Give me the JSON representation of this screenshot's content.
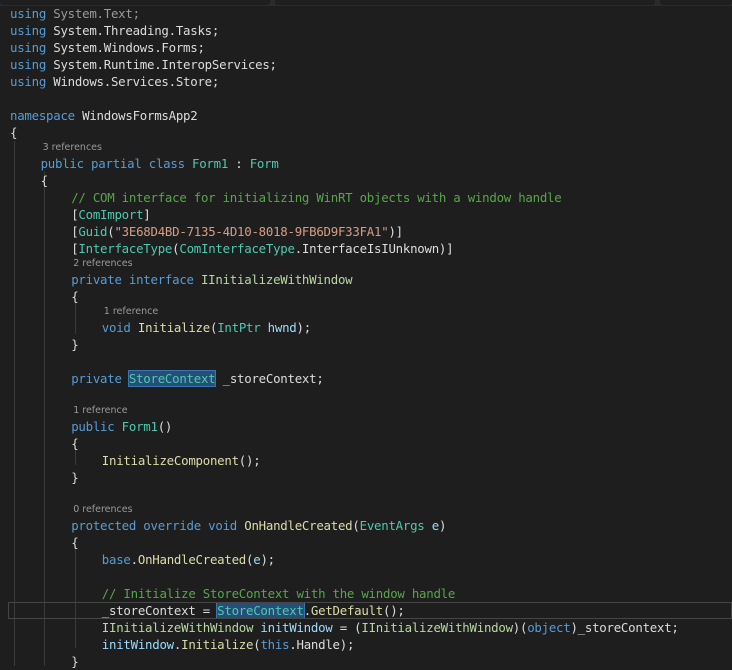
{
  "colors": {
    "background": "#1e1e1e",
    "keyword": "#569cd6",
    "type": "#4ec9b0",
    "string": "#d69d85",
    "comment": "#57a64a",
    "method": "#dcdcaa",
    "variable": "#9cdcfe",
    "highlight": "#264f78"
  },
  "editor": {
    "lines": [
      {
        "indent": 0,
        "tokens": [
          [
            "using ",
            "k"
          ],
          [
            "System.Text;",
            "d"
          ]
        ]
      },
      {
        "indent": 0,
        "tokens": [
          [
            "using ",
            "k"
          ],
          [
            "System.Threading.Tasks;",
            "p"
          ]
        ]
      },
      {
        "indent": 0,
        "tokens": [
          [
            "using ",
            "k"
          ],
          [
            "System.Windows.Forms;",
            "p"
          ]
        ]
      },
      {
        "indent": 0,
        "tokens": [
          [
            "using ",
            "k"
          ],
          [
            "System.Runtime.InteropServices;",
            "p"
          ]
        ]
      },
      {
        "indent": 0,
        "tokens": [
          [
            "using ",
            "k"
          ],
          [
            "Windows.Services.Store;",
            "p"
          ]
        ]
      },
      {
        "indent": 0,
        "tokens": []
      },
      {
        "indent": 0,
        "tokens": [
          [
            "namespace ",
            "k"
          ],
          [
            "WindowsFormsApp2",
            "p"
          ]
        ]
      },
      {
        "indent": 0,
        "tokens": [
          [
            "{",
            "p"
          ]
        ]
      },
      {
        "indent": 1,
        "lens": "3 references"
      },
      {
        "indent": 1,
        "tokens": [
          [
            "public partial class ",
            "k"
          ],
          [
            "Form1",
            "t"
          ],
          [
            " : ",
            "p"
          ],
          [
            "Form",
            "t"
          ]
        ]
      },
      {
        "indent": 1,
        "tokens": [
          [
            "{",
            "p"
          ]
        ]
      },
      {
        "indent": 2,
        "tokens": [
          [
            "// COM interface for initializing WinRT objects with a window handle",
            "c"
          ]
        ]
      },
      {
        "indent": 2,
        "tokens": [
          [
            "[",
            "p"
          ],
          [
            "ComImport",
            "t"
          ],
          [
            "]",
            "p"
          ]
        ]
      },
      {
        "indent": 2,
        "tokens": [
          [
            "[",
            "p"
          ],
          [
            "Guid",
            "t"
          ],
          [
            "(",
            "p"
          ],
          [
            "\"3E68D4BD-7135-4D10-8018-9FB6D9F33FA1\"",
            "s"
          ],
          [
            ")]",
            "p"
          ]
        ]
      },
      {
        "indent": 2,
        "tokens": [
          [
            "[",
            "p"
          ],
          [
            "InterfaceType",
            "t"
          ],
          [
            "(",
            "p"
          ],
          [
            "ComInterfaceType",
            "t"
          ],
          [
            ".InterfaceIsIUnknown)]",
            "p"
          ]
        ]
      },
      {
        "indent": 2,
        "lens": "2 references"
      },
      {
        "indent": 2,
        "tokens": [
          [
            "private interface ",
            "k"
          ],
          [
            "IInitializeWithWindow",
            "i"
          ]
        ]
      },
      {
        "indent": 2,
        "tokens": [
          [
            "{",
            "p"
          ]
        ]
      },
      {
        "indent": 3,
        "lens": "1 reference"
      },
      {
        "indent": 3,
        "tokens": [
          [
            "void ",
            "k"
          ],
          [
            "Initialize",
            "m"
          ],
          [
            "(",
            "p"
          ],
          [
            "IntPtr",
            "t"
          ],
          [
            " ",
            "p"
          ],
          [
            "hwnd",
            "v"
          ],
          [
            ");",
            "p"
          ]
        ]
      },
      {
        "indent": 2,
        "tokens": [
          [
            "}",
            "p"
          ]
        ]
      },
      {
        "indent": 0,
        "tokens": []
      },
      {
        "indent": 2,
        "tokens": [
          [
            "private ",
            "k"
          ],
          [
            "StoreContext",
            "t hl"
          ],
          [
            " _storeContext;",
            "p"
          ]
        ]
      },
      {
        "indent": 0,
        "tokens": []
      },
      {
        "indent": 2,
        "lens": "1 reference"
      },
      {
        "indent": 2,
        "tokens": [
          [
            "public ",
            "k"
          ],
          [
            "Form1",
            "t"
          ],
          [
            "()",
            "p"
          ]
        ]
      },
      {
        "indent": 2,
        "tokens": [
          [
            "{",
            "p"
          ]
        ]
      },
      {
        "indent": 3,
        "tokens": [
          [
            "InitializeComponent",
            "m"
          ],
          [
            "();",
            "p"
          ]
        ]
      },
      {
        "indent": 2,
        "tokens": [
          [
            "}",
            "p"
          ]
        ]
      },
      {
        "indent": 0,
        "tokens": []
      },
      {
        "indent": 2,
        "lens": "0 references"
      },
      {
        "indent": 2,
        "tokens": [
          [
            "protected override void ",
            "k"
          ],
          [
            "OnHandleCreated",
            "m"
          ],
          [
            "(",
            "p"
          ],
          [
            "EventArgs",
            "t"
          ],
          [
            " ",
            "p"
          ],
          [
            "e",
            "v"
          ],
          [
            ")",
            "p"
          ]
        ]
      },
      {
        "indent": 2,
        "tokens": [
          [
            "{",
            "p"
          ]
        ]
      },
      {
        "indent": 3,
        "tokens": [
          [
            "base",
            "k"
          ],
          [
            ".",
            "p"
          ],
          [
            "OnHandleCreated",
            "m"
          ],
          [
            "(",
            "p"
          ],
          [
            "e",
            "v"
          ],
          [
            ");",
            "p"
          ]
        ]
      },
      {
        "indent": 0,
        "tokens": []
      },
      {
        "indent": 3,
        "tokens": [
          [
            "// Initialize StoreContext with the window handle",
            "c"
          ]
        ]
      },
      {
        "indent": 3,
        "current": true,
        "tokens": [
          [
            "_storeContext = ",
            "p"
          ],
          [
            "StoreContext",
            "t hl"
          ],
          [
            ".",
            "p"
          ],
          [
            "GetDefault",
            "m"
          ],
          [
            "();",
            "p"
          ]
        ]
      },
      {
        "indent": 3,
        "tokens": [
          [
            "IInitializeWithWindow",
            "i"
          ],
          [
            " ",
            "p"
          ],
          [
            "initWindow",
            "v"
          ],
          [
            " = (",
            "p"
          ],
          [
            "IInitializeWithWindow",
            "i"
          ],
          [
            ")(",
            "p"
          ],
          [
            "object",
            "k"
          ],
          [
            ")_storeContext;",
            "p"
          ]
        ]
      },
      {
        "indent": 3,
        "tokens": [
          [
            "initWindow",
            "v"
          ],
          [
            ".",
            "p"
          ],
          [
            "Initialize",
            "m"
          ],
          [
            "(",
            "p"
          ],
          [
            "this",
            "k"
          ],
          [
            ".Handle);",
            "p"
          ]
        ]
      },
      {
        "indent": 2,
        "tokens": [
          [
            "}",
            "p"
          ]
        ]
      }
    ]
  }
}
